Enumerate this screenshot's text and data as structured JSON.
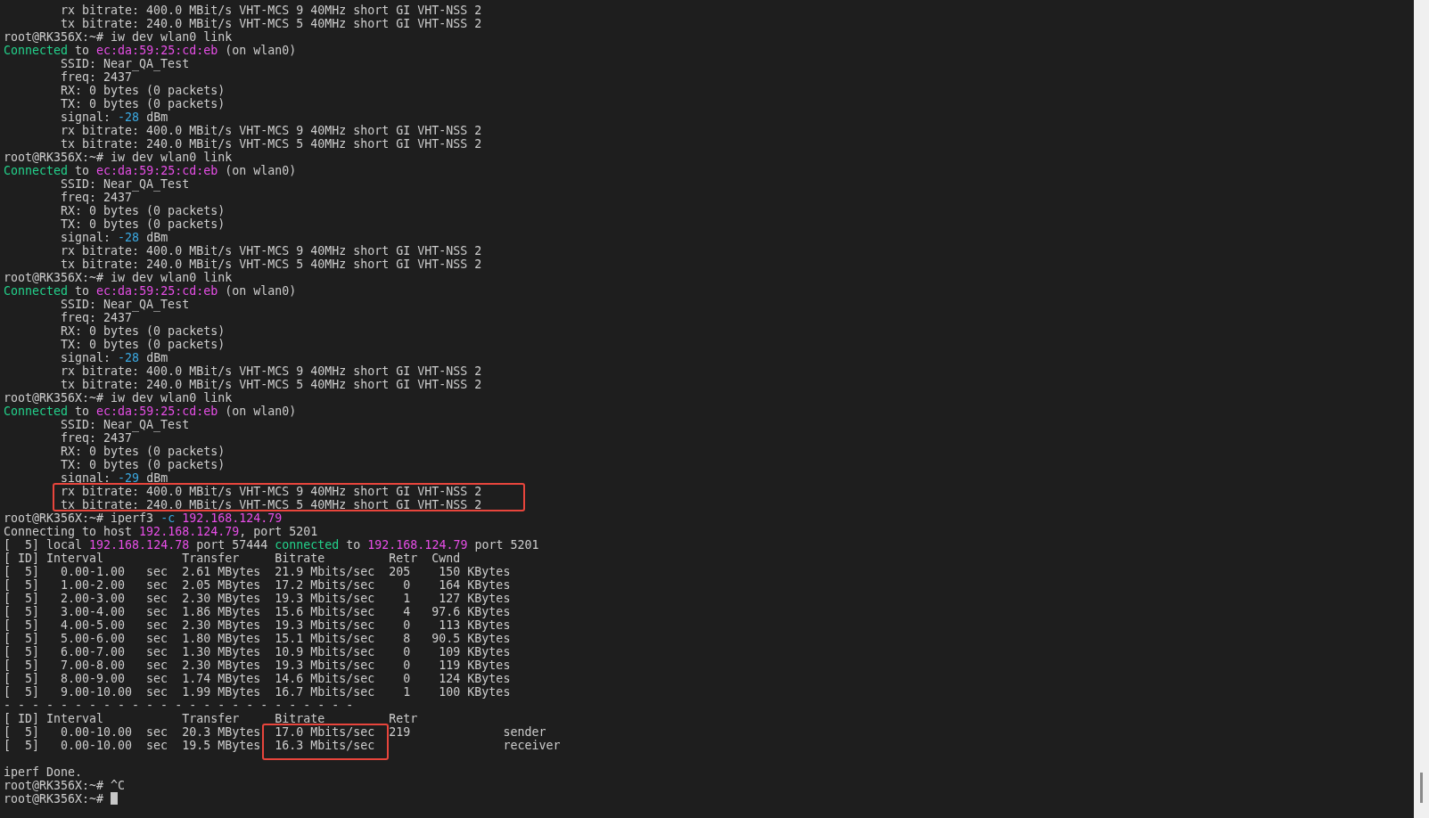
{
  "terminal": {
    "lines": [
      {
        "text": "        rx bitrate: 400.0 MBit/s VHT-MCS 9 40MHz short GI VHT-NSS 2"
      },
      {
        "text": "        tx bitrate: 240.0 MBit/s VHT-MCS 5 40MHz short GI VHT-NSS 2"
      },
      {
        "text": "root@RK356X:~# iw dev wlan0 link"
      },
      {
        "segments": [
          {
            "text": "Connected",
            "color": "#23d18b"
          },
          {
            "text": " to "
          },
          {
            "text": "ec:da:59:25:cd:eb",
            "color": "#e64ee6"
          },
          {
            "text": " (on wlan0)"
          }
        ]
      },
      {
        "text": "        SSID: Near_QA_Test"
      },
      {
        "text": "        freq: 2437"
      },
      {
        "text": "        RX: 0 bytes (0 packets)"
      },
      {
        "text": "        TX: 0 bytes (0 packets)"
      },
      {
        "segments": [
          {
            "text": "        signal: "
          },
          {
            "text": "-28",
            "color": "#3ba8e0"
          },
          {
            "text": " dBm"
          }
        ]
      },
      {
        "text": "        rx bitrate: 400.0 MBit/s VHT-MCS 9 40MHz short GI VHT-NSS 2"
      },
      {
        "text": "        tx bitrate: 240.0 MBit/s VHT-MCS 5 40MHz short GI VHT-NSS 2"
      },
      {
        "text": "root@RK356X:~# iw dev wlan0 link"
      },
      {
        "segments": [
          {
            "text": "Connected",
            "color": "#23d18b"
          },
          {
            "text": " to "
          },
          {
            "text": "ec:da:59:25:cd:eb",
            "color": "#e64ee6"
          },
          {
            "text": " (on wlan0)"
          }
        ]
      },
      {
        "text": "        SSID: Near_QA_Test"
      },
      {
        "text": "        freq: 2437"
      },
      {
        "text": "        RX: 0 bytes (0 packets)"
      },
      {
        "text": "        TX: 0 bytes (0 packets)"
      },
      {
        "segments": [
          {
            "text": "        signal: "
          },
          {
            "text": "-28",
            "color": "#3ba8e0"
          },
          {
            "text": " dBm"
          }
        ]
      },
      {
        "text": "        rx bitrate: 400.0 MBit/s VHT-MCS 9 40MHz short GI VHT-NSS 2"
      },
      {
        "text": "        tx bitrate: 240.0 MBit/s VHT-MCS 5 40MHz short GI VHT-NSS 2"
      },
      {
        "text": "root@RK356X:~# iw dev wlan0 link"
      },
      {
        "segments": [
          {
            "text": "Connected",
            "color": "#23d18b"
          },
          {
            "text": " to "
          },
          {
            "text": "ec:da:59:25:cd:eb",
            "color": "#e64ee6"
          },
          {
            "text": " (on wlan0)"
          }
        ]
      },
      {
        "text": "        SSID: Near_QA_Test"
      },
      {
        "text": "        freq: 2437"
      },
      {
        "text": "        RX: 0 bytes (0 packets)"
      },
      {
        "text": "        TX: 0 bytes (0 packets)"
      },
      {
        "segments": [
          {
            "text": "        signal: "
          },
          {
            "text": "-28",
            "color": "#3ba8e0"
          },
          {
            "text": " dBm"
          }
        ]
      },
      {
        "text": "        rx bitrate: 400.0 MBit/s VHT-MCS 9 40MHz short GI VHT-NSS 2"
      },
      {
        "text": "        tx bitrate: 240.0 MBit/s VHT-MCS 5 40MHz short GI VHT-NSS 2"
      },
      {
        "text": "root@RK356X:~# iw dev wlan0 link"
      },
      {
        "segments": [
          {
            "text": "Connected",
            "color": "#23d18b"
          },
          {
            "text": " to "
          },
          {
            "text": "ec:da:59:25:cd:eb",
            "color": "#e64ee6"
          },
          {
            "text": " (on wlan0)"
          }
        ]
      },
      {
        "text": "        SSID: Near_QA_Test"
      },
      {
        "text": "        freq: 2437"
      },
      {
        "text": "        RX: 0 bytes (0 packets)"
      },
      {
        "text": "        TX: 0 bytes (0 packets)"
      },
      {
        "segments": [
          {
            "text": "        signal: "
          },
          {
            "text": "-29",
            "color": "#3ba8e0"
          },
          {
            "text": " dBm"
          }
        ]
      },
      {
        "text": "        rx bitrate: 400.0 MBit/s VHT-MCS 9 40MHz short GI VHT-NSS 2"
      },
      {
        "text": "        tx bitrate: 240.0 MBit/s VHT-MCS 5 40MHz short GI VHT-NSS 2"
      },
      {
        "segments": [
          {
            "text": "root@RK356X:~# iperf3 "
          },
          {
            "text": "-c",
            "color": "#3ba8e0"
          },
          {
            "text": " 192.168.124.79",
            "color": "#e64ee6"
          }
        ]
      },
      {
        "segments": [
          {
            "text": "Connecting to host "
          },
          {
            "text": "192.168.124.79",
            "color": "#e64ee6"
          },
          {
            "text": ", port 5201"
          }
        ]
      },
      {
        "segments": [
          {
            "text": "[  5] local "
          },
          {
            "text": "192.168.124.78",
            "color": "#e64ee6"
          },
          {
            "text": " port 57444 "
          },
          {
            "text": "connected",
            "color": "#23d18b"
          },
          {
            "text": " to "
          },
          {
            "text": "192.168.124.79",
            "color": "#e64ee6"
          },
          {
            "text": " port 5201"
          }
        ]
      },
      {
        "text": "[ ID] Interval           Transfer     Bitrate         Retr  Cwnd"
      },
      {
        "text": "[  5]   0.00-1.00   sec  2.61 MBytes  21.9 Mbits/sec  205    150 KBytes"
      },
      {
        "text": "[  5]   1.00-2.00   sec  2.05 MBytes  17.2 Mbits/sec    0    164 KBytes"
      },
      {
        "text": "[  5]   2.00-3.00   sec  2.30 MBytes  19.3 Mbits/sec    1    127 KBytes"
      },
      {
        "text": "[  5]   3.00-4.00   sec  1.86 MBytes  15.6 Mbits/sec    4   97.6 KBytes"
      },
      {
        "text": "[  5]   4.00-5.00   sec  2.30 MBytes  19.3 Mbits/sec    0    113 KBytes"
      },
      {
        "text": "[  5]   5.00-6.00   sec  1.80 MBytes  15.1 Mbits/sec    8   90.5 KBytes"
      },
      {
        "text": "[  5]   6.00-7.00   sec  1.30 MBytes  10.9 Mbits/sec    0    109 KBytes"
      },
      {
        "text": "[  5]   7.00-8.00   sec  2.30 MBytes  19.3 Mbits/sec    0    119 KBytes"
      },
      {
        "text": "[  5]   8.00-9.00   sec  1.74 MBytes  14.6 Mbits/sec    0    124 KBytes"
      },
      {
        "text": "[  5]   9.00-10.00  sec  1.99 MBytes  16.7 Mbits/sec    1    100 KBytes"
      },
      {
        "text": "- - - - - - - - - - - - - - - - - - - - - - - - -"
      },
      {
        "text": "[ ID] Interval           Transfer     Bitrate         Retr"
      },
      {
        "text": "[  5]   0.00-10.00  sec  20.3 MBytes  17.0 Mbits/sec  219             sender"
      },
      {
        "text": "[  5]   0.00-10.00  sec  19.5 MBytes  16.3 Mbits/sec                  receiver"
      },
      {
        "kind": "blank"
      },
      {
        "text": "iperf Done."
      },
      {
        "text": "root@RK356X:~# ^C"
      },
      {
        "text": "root@RK356X:~# ",
        "cursor": true
      }
    ]
  },
  "annotations": [
    {
      "kind": "box",
      "color": "#e8453c"
    },
    {
      "kind": "box",
      "color": "#e8453c"
    }
  ]
}
